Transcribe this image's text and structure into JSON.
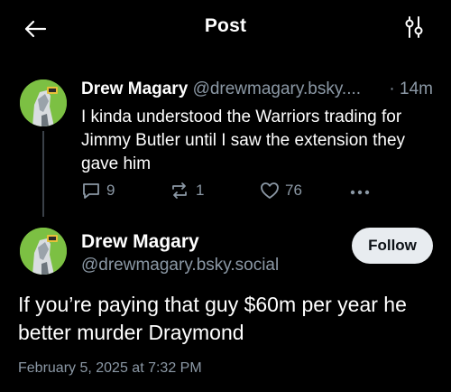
{
  "header": {
    "title": "Post",
    "back_icon": "arrow-left-icon",
    "filter_icon": "sliders-icon"
  },
  "parent_post": {
    "display_name": "Drew Magary",
    "handle": "@drewmagary.bsky....",
    "time": "· 14m",
    "text": "I kinda understood the Warriors trading for Jimmy Butler until I saw the extension they gave him",
    "replies": "9",
    "reposts": "1",
    "likes": "76"
  },
  "main_post": {
    "display_name": "Drew Magary",
    "handle": "@drewmagary.bsky.social",
    "follow_label": "Follow",
    "text": "If you’re paying that guy $60m per year he better murder Draymond",
    "timestamp": "February 5, 2025 at 7:32 PM"
  },
  "colors": {
    "background": "#000000",
    "secondary_text": "#8b98a5",
    "avatar_green": "#7cc043",
    "follow_bg": "#e8ecf0"
  }
}
